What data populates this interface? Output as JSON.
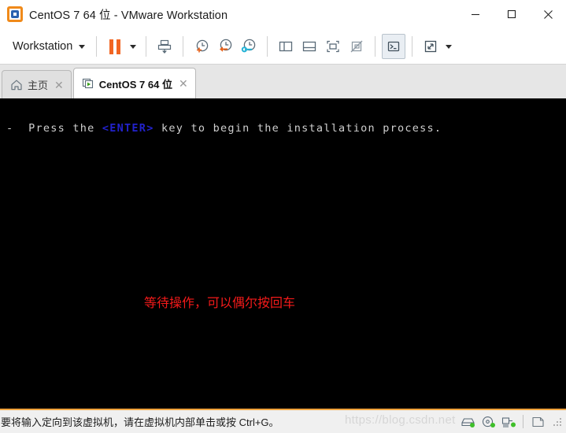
{
  "window": {
    "title": "CentOS 7 64 位 - VMware Workstation",
    "logo_icon": "vmware-logo-icon",
    "controls": {
      "minimize": "minimize-icon",
      "maximize": "maximize-icon",
      "close": "close-icon"
    }
  },
  "toolbar": {
    "menu_label": "Workstation",
    "menu_caret_icon": "chevron-down-icon",
    "buttons": [
      {
        "name": "suspend-button",
        "icon": "pause-icon",
        "tooltip": "Suspend"
      },
      {
        "name": "suspend-dropdown",
        "icon": "chevron-down-icon",
        "tooltip": "Power options"
      },
      {
        "name": "take-snapshot-button",
        "icon": "snapshot-take-icon",
        "tooltip": "Take a snapshot"
      },
      {
        "name": "snapshot-new-button",
        "icon": "clock-plus-icon",
        "tooltip": "Take snapshot of this virtual machine"
      },
      {
        "name": "revert-snapshot-button",
        "icon": "clock-revert-icon",
        "tooltip": "Revert to snapshot"
      },
      {
        "name": "snapshot-manager-button",
        "icon": "clock-wrench-icon",
        "tooltip": "Manage snapshots"
      },
      {
        "name": "show-library-button",
        "icon": "panel-left-icon",
        "tooltip": "Show or hide the library"
      },
      {
        "name": "show-thumbnails-button",
        "icon": "panel-bottom-icon",
        "tooltip": "Show or hide thumbnail bar"
      },
      {
        "name": "fit-guest-button",
        "icon": "fit-guest-icon",
        "tooltip": "Autofit guest"
      },
      {
        "name": "fit-window-disabled-button",
        "icon": "fit-window-off-icon",
        "tooltip": "Autofit window"
      },
      {
        "name": "console-view-button",
        "icon": "terminal-icon",
        "tooltip": "Console view",
        "active": true
      },
      {
        "name": "fullscreen-button",
        "icon": "fullscreen-icon",
        "tooltip": "Enter full screen"
      },
      {
        "name": "fullscreen-dropdown",
        "icon": "chevron-down-icon",
        "tooltip": "Full screen options"
      }
    ]
  },
  "tabs": [
    {
      "label": "主页",
      "icon": "home-icon",
      "active": false,
      "close_icon": "close-icon"
    },
    {
      "label": "CentOS 7 64 位",
      "icon": "vm-running-icon",
      "active": true,
      "close_icon": "close-icon"
    }
  ],
  "console": {
    "line_prefix": "-  Press the ",
    "line_key": "<ENTER>",
    "line_suffix": " key to begin the installation process.",
    "key_color": "#2222cc",
    "text_color": "#cfcfcf",
    "background": "#000000",
    "annotation": "等待操作，可以偶尔按回车",
    "annotation_color": "#f41a1a"
  },
  "statusbar": {
    "message": "要将输入定向到该虚拟机，请在虚拟机内部单击或按 Ctrl+G。",
    "accent_color": "#f2a33c",
    "watermark": "https://blog.csdn.net",
    "devices": [
      {
        "name": "status-harddisk-icon",
        "icon": "harddisk-icon",
        "connected": true
      },
      {
        "name": "status-cdrom-icon",
        "icon": "cdrom-icon",
        "connected": true
      },
      {
        "name": "status-network-icon",
        "icon": "network-icon",
        "connected": true
      },
      {
        "name": "status-usb-icon",
        "icon": "usb-icon",
        "connected": false
      }
    ],
    "grip_icon": "resize-grip-icon"
  }
}
